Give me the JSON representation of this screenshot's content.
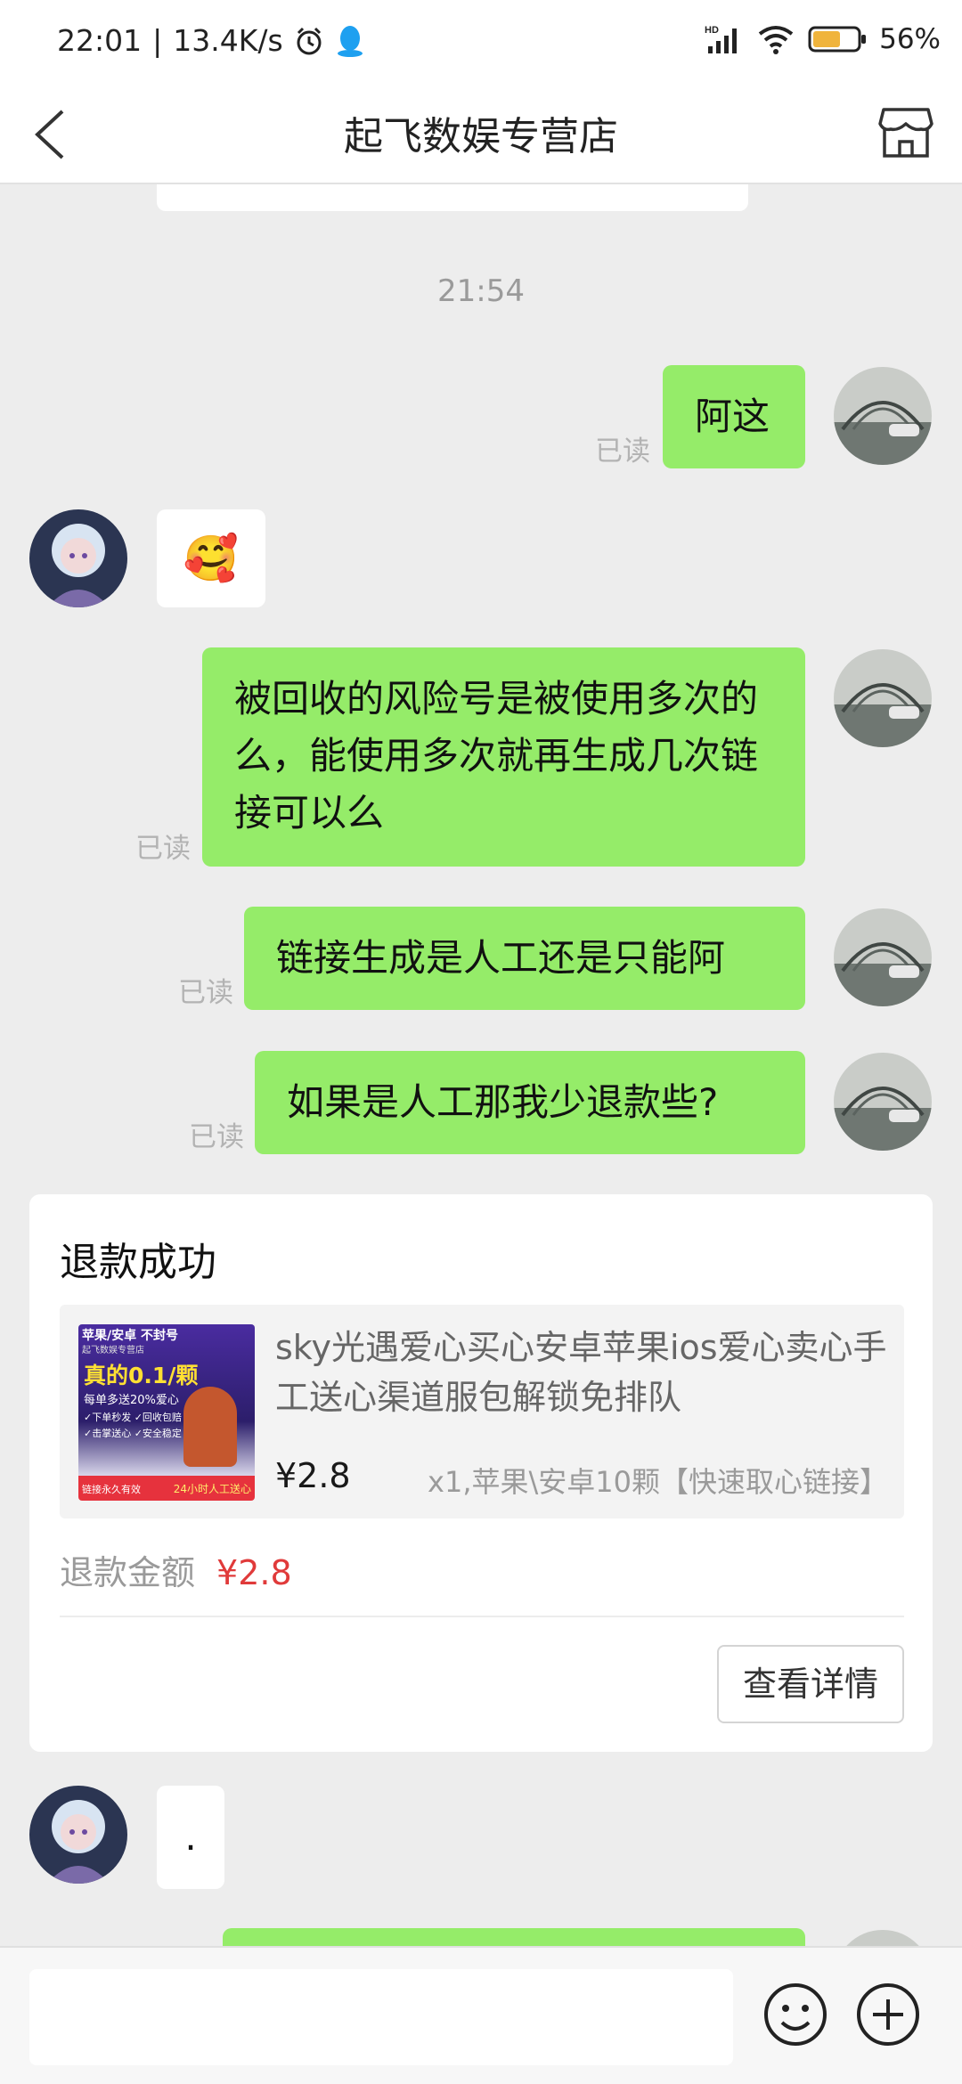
{
  "status": {
    "time": "22:01",
    "speed": "13.4K/s",
    "network": "HD",
    "battery": "56%"
  },
  "nav": {
    "title": "起飞数娱专营店"
  },
  "chat": {
    "timestamp": "21:54",
    "read_label": "已读",
    "messages": [
      {
        "side": "me",
        "text": "阿这"
      },
      {
        "side": "other",
        "text": "🥰"
      },
      {
        "side": "me",
        "text": "被回收的风险号是被使用多次的么，能使用多次就再生成几次链接可以么"
      },
      {
        "side": "me",
        "text": "链接生成是人工还是只能阿"
      },
      {
        "side": "me",
        "text": "如果是人工那我少退款些?"
      },
      {
        "side": "other",
        "text": "."
      }
    ]
  },
  "refund_card": {
    "title": "退款成功",
    "product_name": "sky光遇爱心买心安卓苹果ios爱心卖心手工送心渠道服包解锁免排队",
    "price": "¥2.8",
    "spec": "x1,苹果\\安卓10颗【快速取心链接】",
    "refund_label": "退款金额",
    "refund_amount": "¥2.8",
    "detail_button": "查看详情",
    "thumb": {
      "line1": "苹果/安卓 不封号",
      "line2": "起飞数娱专营店",
      "line3": "真的0.1/颗",
      "line4": "每单多送20%爱心",
      "line5": "✓下单秒发 ✓回收包赔 ✓击掌送心 ✓安全稳定",
      "line6": "链接永久有效",
      "line7": "24小时人工送心"
    }
  },
  "input": {
    "placeholder": ""
  }
}
